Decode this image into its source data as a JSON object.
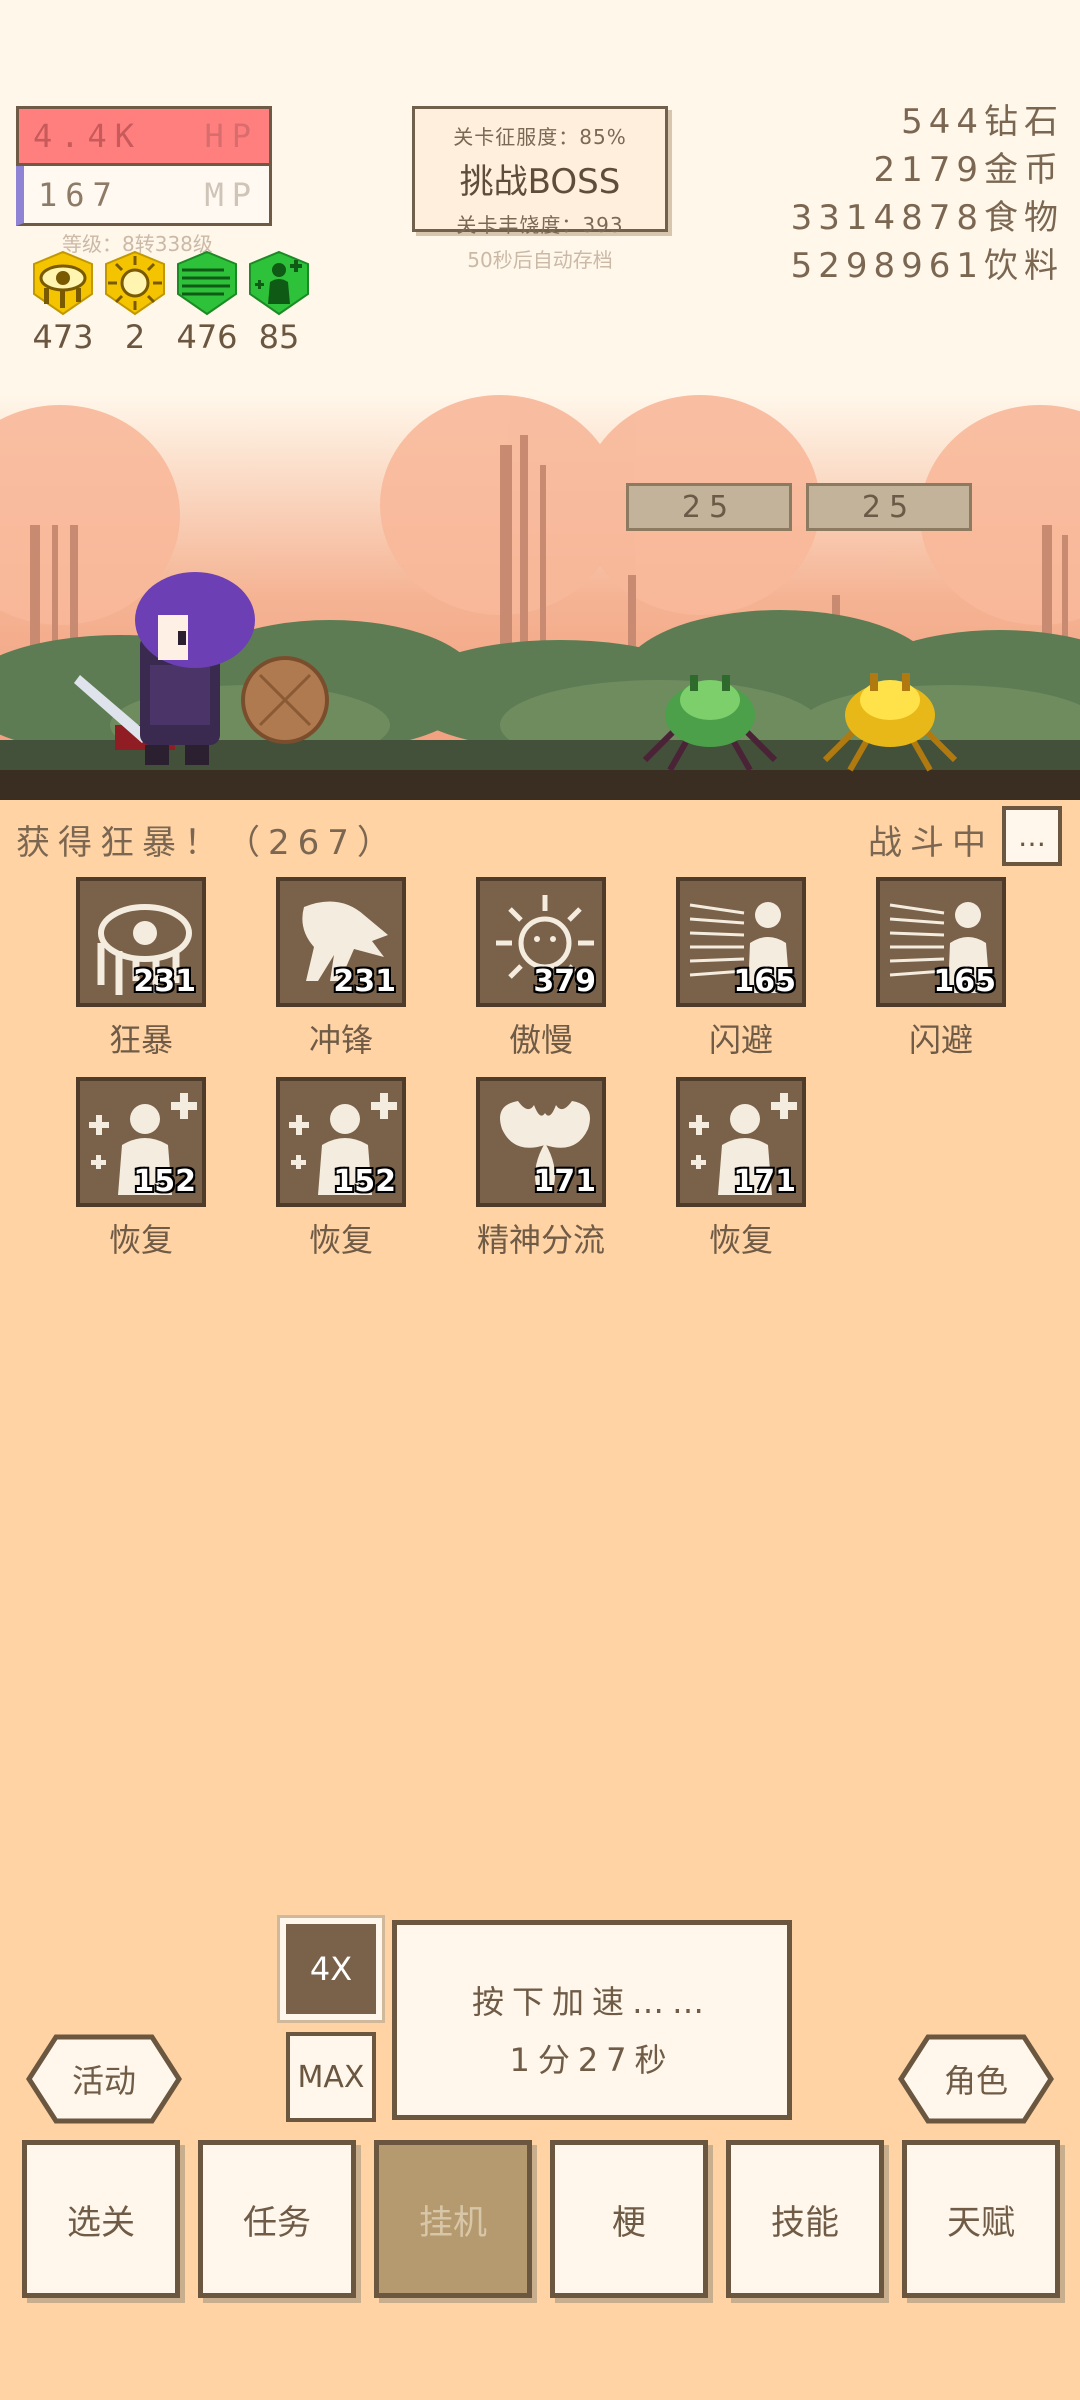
{
  "player": {
    "hp_value": "4.4K",
    "hp_label": "HP",
    "mp_value": "167",
    "mp_label": "MP",
    "level": "等级：8转338级"
  },
  "buffs": [
    {
      "icon": "weeping-eye-icon",
      "count": "473"
    },
    {
      "icon": "sun-face-icon",
      "count": "2"
    },
    {
      "icon": "speed-lines-icon",
      "count": "476"
    },
    {
      "icon": "heal-plus-icon",
      "count": "85"
    }
  ],
  "boss_panel": {
    "conquest": "关卡征服度：85%",
    "title": "挑战BOSS",
    "richness": "关卡丰饶度：393",
    "autosave": "50秒后自动存档"
  },
  "resources": [
    {
      "label": "544钻石"
    },
    {
      "label": "2179金币"
    },
    {
      "label": "3314878食物"
    },
    {
      "label": "5298961饮料"
    }
  ],
  "enemy_timers": [
    "25",
    "25"
  ],
  "status": {
    "message": "获得狂暴！（267）",
    "state": "战斗中",
    "more": "…"
  },
  "skills": [
    {
      "name": "狂暴",
      "count": "231",
      "icon": "weeping-eye-icon"
    },
    {
      "name": "冲锋",
      "count": "231",
      "icon": "charging-bull-icon"
    },
    {
      "name": "傲慢",
      "count": "379",
      "icon": "sun-face-icon"
    },
    {
      "name": "闪避",
      "count": "165",
      "icon": "dodge-figure-icon"
    },
    {
      "name": "闪避",
      "count": "165",
      "icon": "dodge-figure-icon"
    },
    {
      "name": "恢复",
      "count": "152",
      "icon": "heal-plus-icon"
    },
    {
      "name": "恢复",
      "count": "152",
      "icon": "heal-plus-icon"
    },
    {
      "name": "精神分流",
      "count": "171",
      "icon": "brain-split-icon"
    },
    {
      "name": "恢复",
      "count": "171",
      "icon": "heal-plus-icon"
    }
  ],
  "speed": {
    "btn_4x": "4X",
    "btn_max": "MAX",
    "line1": "按下加速……",
    "line2": "1分27秒"
  },
  "side_buttons": {
    "left": "活动",
    "right": "角色"
  },
  "nav": [
    "选关",
    "任务",
    "挂机",
    "梗",
    "技能",
    "天赋"
  ],
  "colors": {
    "hp_fill": "#ff7f7f",
    "mp_accent": "#8f83d6",
    "background": "#ffd3a4",
    "panel": "#fff7ec",
    "border": "#6b5740"
  }
}
